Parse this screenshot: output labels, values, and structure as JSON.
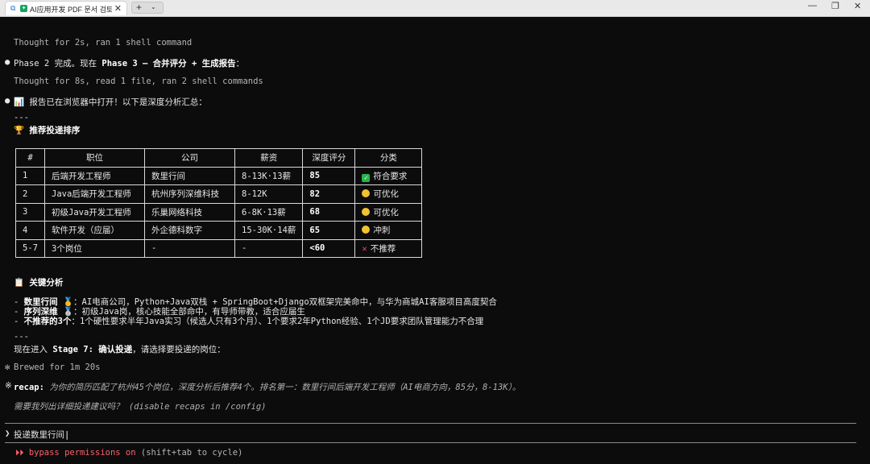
{
  "window": {
    "tab_title": "AI应用开发 PDF 문서 검토",
    "tab_close": "✕",
    "new_tab": "+",
    "tab_menu": "⌄",
    "minimize": "—",
    "maximize": "❐",
    "close": "✕"
  },
  "log": {
    "thought1": "Thought for 2s, ran 1 shell command",
    "phase_msg_prefix": "Phase 2 完成。现在 ",
    "phase_msg_bold": "Phase 3 – 合并评分 + 生成报告",
    "phase_msg_suffix": "：",
    "thought2": "Thought for 8s, read 1 file, ran 2 shell commands",
    "report_icon": "📊",
    "report_msg": "报告已在浏览器中打开！以下是深度分析汇总：",
    "hr1": "---",
    "rank_icon": "🏆",
    "rank_heading": "推荐投递排序"
  },
  "table": {
    "headers": [
      "#",
      "职位",
      "公司",
      "薪资",
      "深度评分",
      "分类"
    ],
    "rows": [
      {
        "no": "1",
        "title": "后端开发工程师",
        "company": "数里行间",
        "salary": "8-13K·13薪",
        "score": "85",
        "status_icon": "check",
        "status": "符合要求"
      },
      {
        "no": "2",
        "title": "Java后端开发工程师",
        "company": "杭州序列深维科技",
        "salary": "8-12K",
        "score": "82",
        "status_icon": "dot",
        "status": "可优化"
      },
      {
        "no": "3",
        "title": "初级Java开发工程师",
        "company": "乐巢网络科技",
        "salary": "6-8K·13薪",
        "score": "68",
        "status_icon": "dot",
        "status": "可优化"
      },
      {
        "no": "4",
        "title": "软件开发（应届）",
        "company": "外企德科数字",
        "salary": "15-30K·14薪",
        "score": "65",
        "status_icon": "dot",
        "status": "冲刺"
      },
      {
        "no": "5-7",
        "title": "3个岗位",
        "company": "-",
        "salary": "-",
        "score": "<60",
        "status_icon": "cross",
        "status": "不推荐"
      }
    ]
  },
  "analysis": {
    "icon": "📋",
    "heading": "关键分析",
    "items": [
      {
        "lead": "数里行间",
        "medal": "🥇",
        "text": "：AI电商公司，Python+Java双栈 + SpringBoot+Django双框架完美命中，与华为商城AI客服项目高度契合"
      },
      {
        "lead": "序列深维",
        "medal": "🥈",
        "text": "：初级Java岗，核心技能全部命中，有导师带教，适合应届生"
      },
      {
        "lead": "不推荐的3个",
        "medal": "",
        "text": "：1个硬性要求半年Java实习（候选人只有3个月）、1个要求2年Python经验、1个JD要求团队管理能力不合理"
      }
    ],
    "hr2": "---",
    "stage_prefix": "现在进入 ",
    "stage_bold": "Stage 7: 确认投递",
    "stage_suffix": "，请选择要投递的岗位："
  },
  "status": {
    "brewed_icon": "✻",
    "brewed": "Brewed for 1m 20s",
    "recap_icon": "※",
    "recap_label": "recap:",
    "recap_text": "为你的简历匹配了杭州45个岗位，深度分析后推荐4个。排名第一：数里行间后端开发工程师（AI电商方向，85分，8-13K）。",
    "recap_q": "需要我列出详细投递建议吗？ (disable recaps in /config)"
  },
  "prompt": {
    "chevron": "❯",
    "input": "投递数里行间"
  },
  "footer": {
    "arrows": "⏵⏵",
    "bypass": "bypass permissions on",
    "hint": " (shift+tab to cycle)"
  }
}
